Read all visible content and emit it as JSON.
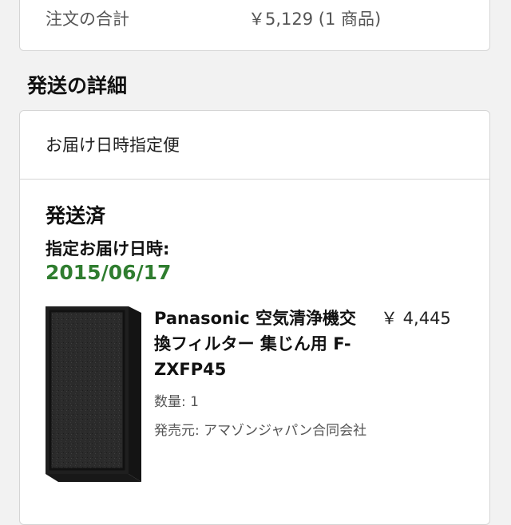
{
  "order_summary": {
    "label": "注文の合計",
    "value": "￥5,129 (1 商品)"
  },
  "shipping_details": {
    "title": "発送の詳細",
    "delivery_type": "お届け日時指定便",
    "status": "発送済",
    "date_label": "指定お届け日時:",
    "date": "2015/06/17"
  },
  "product": {
    "image_icon": "air-filter-product-image",
    "title": "Panasonic 空気清浄機交換フィルター 集じん用 F-ZXFP45",
    "price": "￥ 4,445",
    "quantity": "数量: 1",
    "seller": "発売元: アマゾンジャパン合同会社"
  },
  "colors": {
    "date_green": "#2f7d2f",
    "border": "#d5d5d5",
    "background": "#f2f2f2"
  }
}
